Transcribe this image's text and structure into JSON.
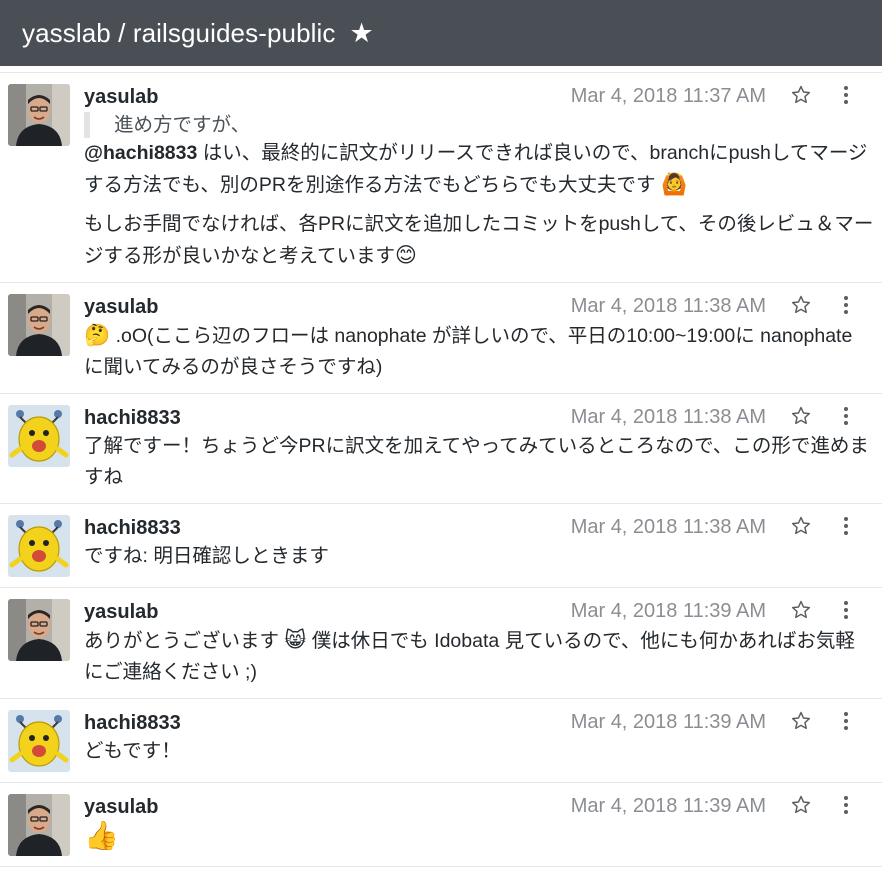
{
  "header": {
    "title": "yasslab / railsguides-public",
    "star": "★"
  },
  "messages": [
    {
      "author": "yasulab",
      "avatar": "yasulab",
      "time": "Mar 4, 2018 11:37 AM",
      "quote": "進め方ですが、",
      "mention": "@hachi8833",
      "text1": " はい、最終的に訳文がリリースできれば良いので、branchにpushしてマージする方法でも、別のPRを別途作る方法でもどちらでも大丈夫です ",
      "emoji1": "🙆",
      "text2": "もしお手間でなければ、各PRに訳文を追加したコミットをpushして、その後レビュ＆マージする形が良いかなと考えています",
      "emoji2": "😊"
    },
    {
      "author": "yasulab",
      "avatar": "yasulab",
      "time": "Mar 4, 2018 11:38 AM",
      "emoji1": "🤔",
      "text1": " .oO(ここら辺のフローは nanophate が詳しいので、平日の10:00~19:00に nanophate に聞いてみるのが良さそうですね)"
    },
    {
      "author": "hachi8833",
      "avatar": "hachi8833",
      "time": "Mar 4, 2018 11:38 AM",
      "text1": "了解ですー！ちょうど今PRに訳文を加えてやってみているところなので、この形で進めますね"
    },
    {
      "author": "hachi8833",
      "avatar": "hachi8833",
      "time": "Mar 4, 2018 11:38 AM",
      "text1": "ですね: 明日確認しときます"
    },
    {
      "author": "yasulab",
      "avatar": "yasulab",
      "time": "Mar 4, 2018 11:39 AM",
      "text1": "ありがとうございます ",
      "emoji1": "😸",
      "text2": " 僕は休日でも Idobata 見ているので、他にも何かあればお気軽にご連絡ください ;)"
    },
    {
      "author": "hachi8833",
      "avatar": "hachi8833",
      "time": "Mar 4, 2018 11:39 AM",
      "text1": "どもです！"
    },
    {
      "author": "yasulab",
      "avatar": "yasulab",
      "time": "Mar 4, 2018 11:39 AM",
      "emoji1": "👍"
    }
  ],
  "icons": {
    "favorite": "star-outline-icon",
    "menu": "kebab-menu-icon",
    "repo_star": "star-filled-icon"
  },
  "colors": {
    "header_bg": "#4a4e55",
    "time": "#8a8e93",
    "divider": "#e7e7e7"
  }
}
